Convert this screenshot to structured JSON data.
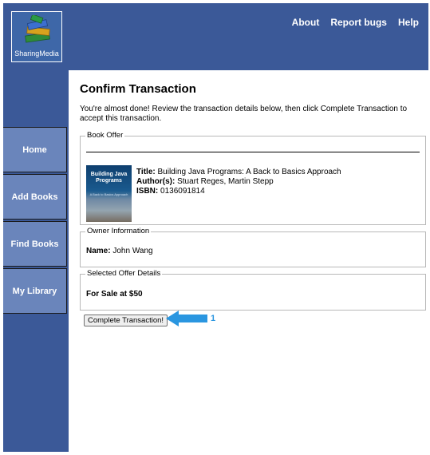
{
  "header": {
    "logo_text": "SharingMedia",
    "nav": [
      "About",
      "Report bugs",
      "Help"
    ]
  },
  "sidebar": {
    "items": [
      "Home",
      "Add Books",
      "Find Books",
      "My Library"
    ]
  },
  "main": {
    "title": "Confirm Transaction",
    "intro": "You're almost done! Review the transaction details below, then click Complete Transaction to accept this transaction.",
    "book_offer": {
      "legend": "Book Offer",
      "cover_title": "Building Java Programs",
      "cover_subtitle": "A Back to Basics Approach",
      "title_label": "Title:",
      "title_value": "Building Java Programs: A Back to Basics Approach",
      "authors_label": "Author(s):",
      "authors_value": "Stuart Reges, Martin Stepp",
      "isbn_label": "ISBN:",
      "isbn_value": "0136091814"
    },
    "owner": {
      "legend": "Owner Information",
      "name_label": "Name:",
      "name_value": "John Wang"
    },
    "offer": {
      "legend": "Selected Offer Details",
      "text": "For Sale at $50"
    },
    "submit_label": "Complete Transaction!",
    "annotation": "1"
  },
  "colors": {
    "header_bg": "#3b5998",
    "nav_button_bg": "#6a85bb",
    "arrow": "#2a96e0"
  }
}
